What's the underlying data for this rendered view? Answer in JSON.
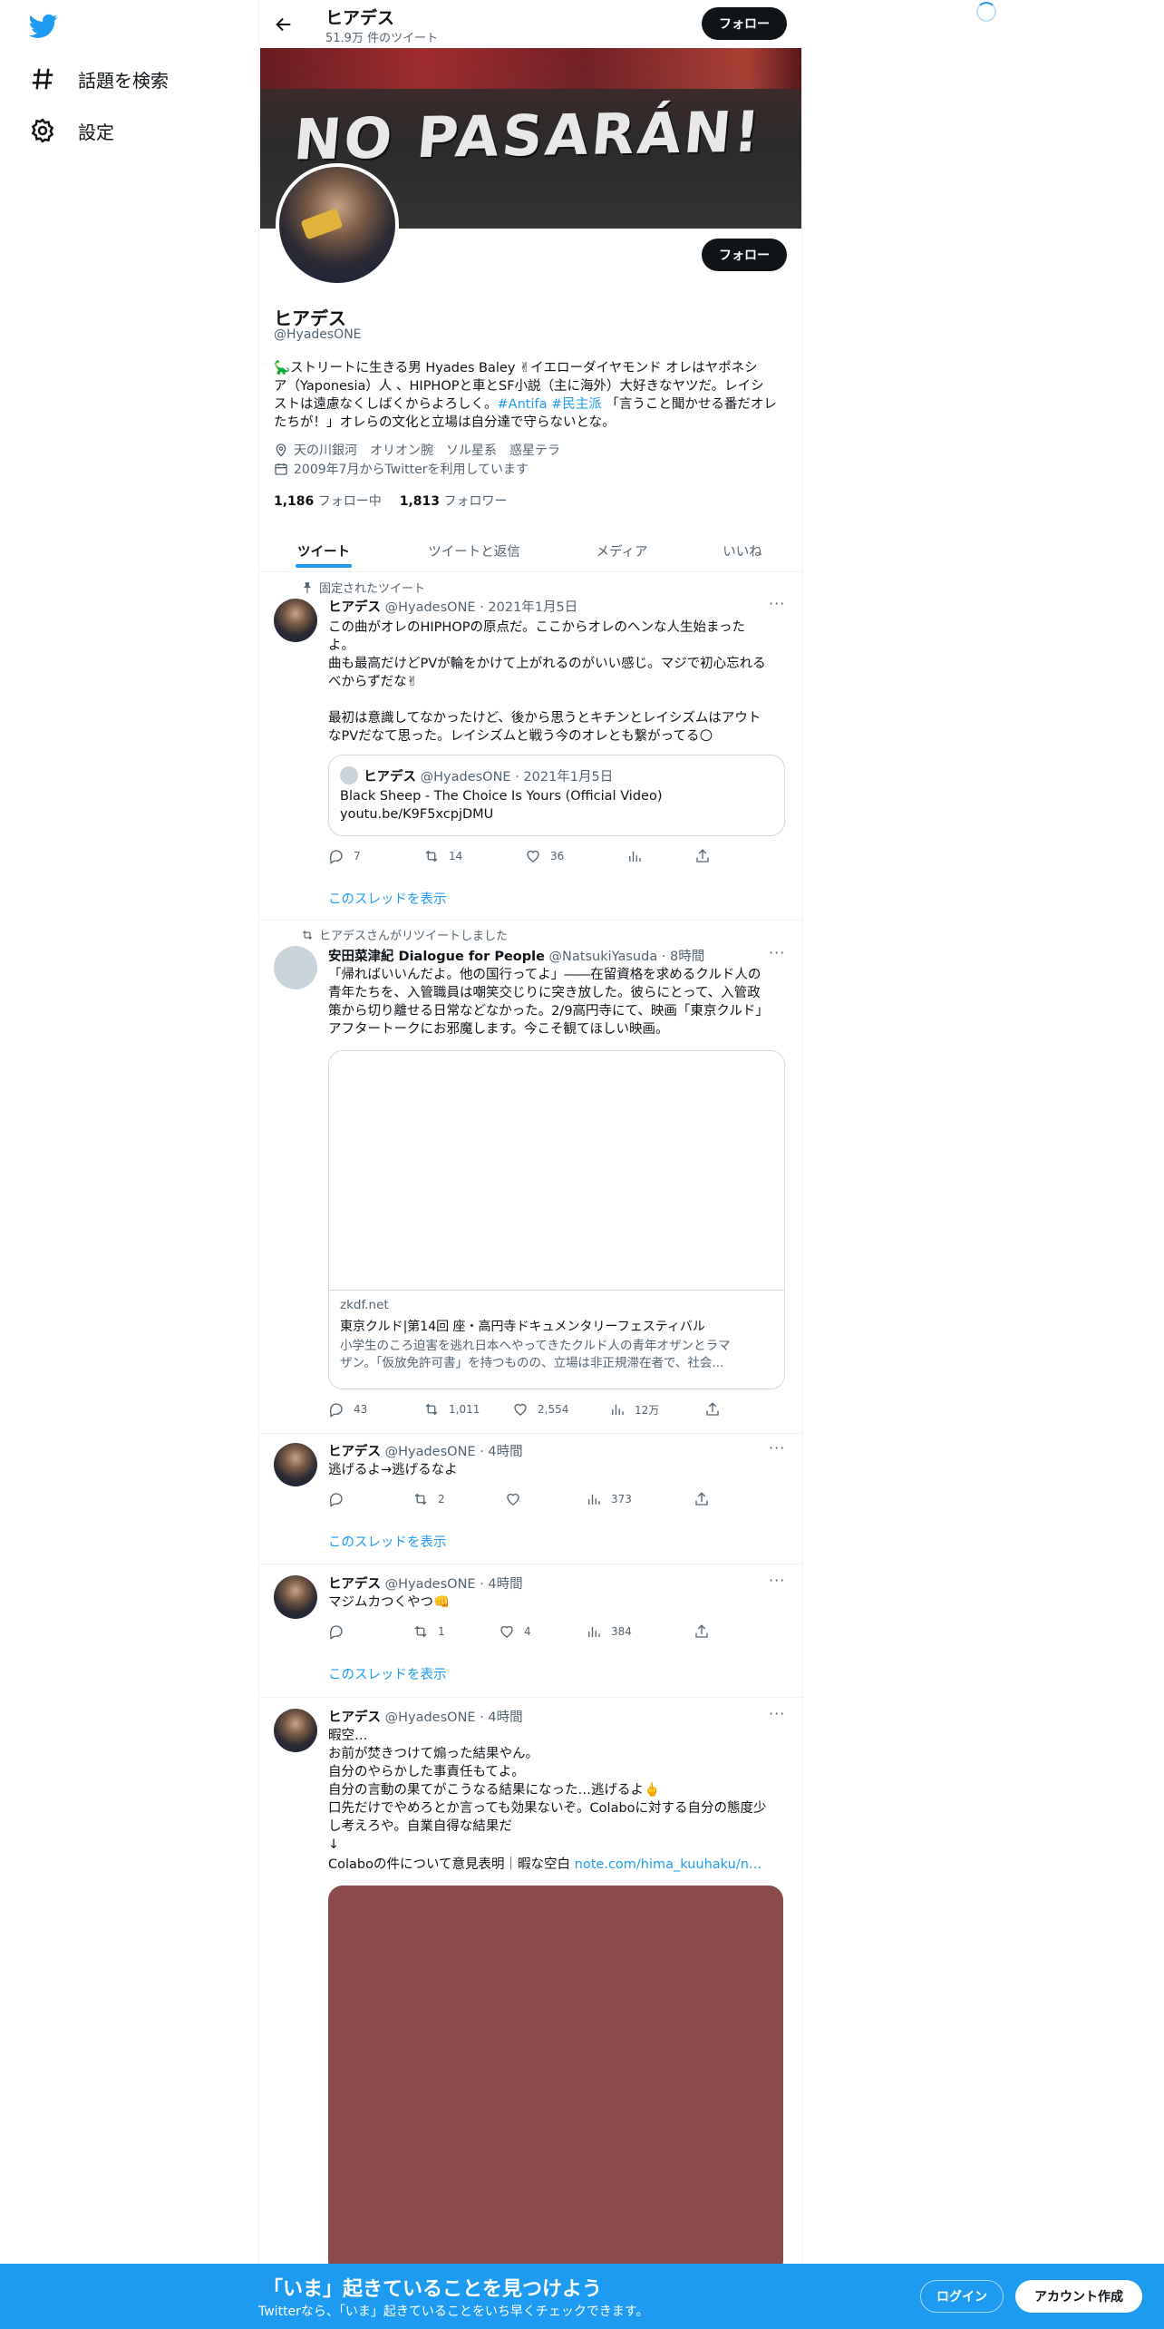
{
  "sidebar": {
    "explore_label": "話題を検索",
    "settings_label": "設定"
  },
  "header": {
    "title": "ヒアデス",
    "subtitle": "51.9万 件のツイート",
    "follow_label": "フォロー"
  },
  "banner": {
    "text": "NO PASARÁN!"
  },
  "profile": {
    "follow_label": "フォロー",
    "name": "ヒアデス",
    "handle": "@HyadesONE",
    "bio_line1": "🦕ストリートに生きる男 Hyades Baley ✌イエローダイヤモンド オレはヤポネシ",
    "bio_line2": "ア（Yaponesia）人 、HIPHOPと車とSF小説（主に海外）大好きなヤツだ。レイシ",
    "bio_line3_a": "ストは遠慮なくしばくからよろしく。",
    "bio_tag1": "#Antifa",
    "bio_tag2": "#民主派",
    "bio_line3_b": " 「言うこと聞かせる番だオレ",
    "bio_line4": "たちが！」オレらの文化と立場は自分達で守らないとな。",
    "location": "天の川銀河　オリオン腕　ソル星系　惑星テラ",
    "joined": "2009年7月からTwitterを利用しています",
    "following_count": "1,186",
    "following_label": "フォロー中",
    "followers_count": "1,813",
    "followers_label": "フォロワー"
  },
  "tabs": [
    "ツイート",
    "ツイートと返信",
    "メディア",
    "いいね"
  ],
  "tweets": [
    {
      "context": "固定されたツイート",
      "name": "ヒアデス",
      "meta": "@HyadesONE · 2021年1月5日",
      "text": "この曲がオレのHIPHOPの原点だ。ここからオレのヘンな人生始まった\nよ。\n曲も最高だけどPVが輪をかけて上がれるのがいい感じ。マジで初心忘れる\nべからずだな✌\n\n最初は意識してなかったけど、後から思うとキチンとレイシズムはアウト\nなPVだなて思った。レイシズムと戦う今のオレとも繋がってる🌕",
      "quote_name": "ヒアデス",
      "quote_meta": "@HyadesONE · 2021年1月5日",
      "quote_line1": "Black Sheep - The Choice Is Yours (Official Video)",
      "quote_line2": "youtu.be/K9F5xcpjDMU",
      "reply": "7",
      "retweet": "14",
      "like": "36",
      "thread": "このスレッドを表示"
    },
    {
      "context": "ヒアデスさんがリツイートしました",
      "name": "安田菜津紀 Dialogue for People",
      "meta": "@NatsukiYasuda · 8時間",
      "text": "「帰ればいいんだよ。他の国行ってよ」――在留資格を求めるクルド人の\n青年たちを、入管職員は嘲笑交じりに突き放した。彼らにとって、入管政\n策から切り離せる日常などなかった。2/9高円寺にて、映画「東京クルド」\nアフタートークにお邪魔します。今こそ観てほしい映画。",
      "card_domain": "zkdf.net",
      "card_title": "東京クルド|第14回 座・高円寺ドキュメンタリーフェスティバル",
      "card_desc1": "小学生のころ迫害を逃れ日本へやってきたクルド人の青年オザンとラマ",
      "card_desc2": "ザン。「仮放免許可書」を持つものの、立場は非正規滞在者で、社会...",
      "reply": "43",
      "retweet": "1,011",
      "like": "2,554",
      "views": "12万"
    },
    {
      "name": "ヒアデス",
      "meta": "@HyadesONE · 4時間",
      "text": "逃げるよ→逃げるなよ",
      "retweet": "2",
      "views": "373",
      "thread": "このスレッドを表示"
    },
    {
      "name": "ヒアデス",
      "meta": "@HyadesONE · 4時間",
      "text": "マジムカつくやつ👊",
      "retweet": "1",
      "like": "4",
      "views": "384",
      "thread": "このスレッドを表示"
    },
    {
      "name": "ヒアデス",
      "meta": "@HyadesONE · 4時間",
      "text": "暇空…\nお前が焚きつけて煽った結果やん。\n自分のやらかした事責任もてよ。\n自分の言動の果てがこうなる結果になった…逃げるよ🖕\n口先だけでやめろとか言っても効果ないぞ。Colaboに対する自分の態度少\nし考えろや。自業自得な結果だ\n↓",
      "link_prefix": "Colaboの件について意見表明｜暇な空白 ",
      "link_text": "note.com/hima_kuuhaku/n…"
    }
  ],
  "bottom_bar": {
    "title": "「いま」起きていることを見つけよう",
    "subtitle": "Twitterなら、「いま」起きていることをいち早くチェックできます。",
    "login_label": "ログイン",
    "signup_label": "アカウント作成"
  },
  "colors": {
    "accent": "#1d9bf0",
    "text": "#0f1419",
    "muted": "#536471",
    "media_placeholder": "#8b4a4c"
  }
}
